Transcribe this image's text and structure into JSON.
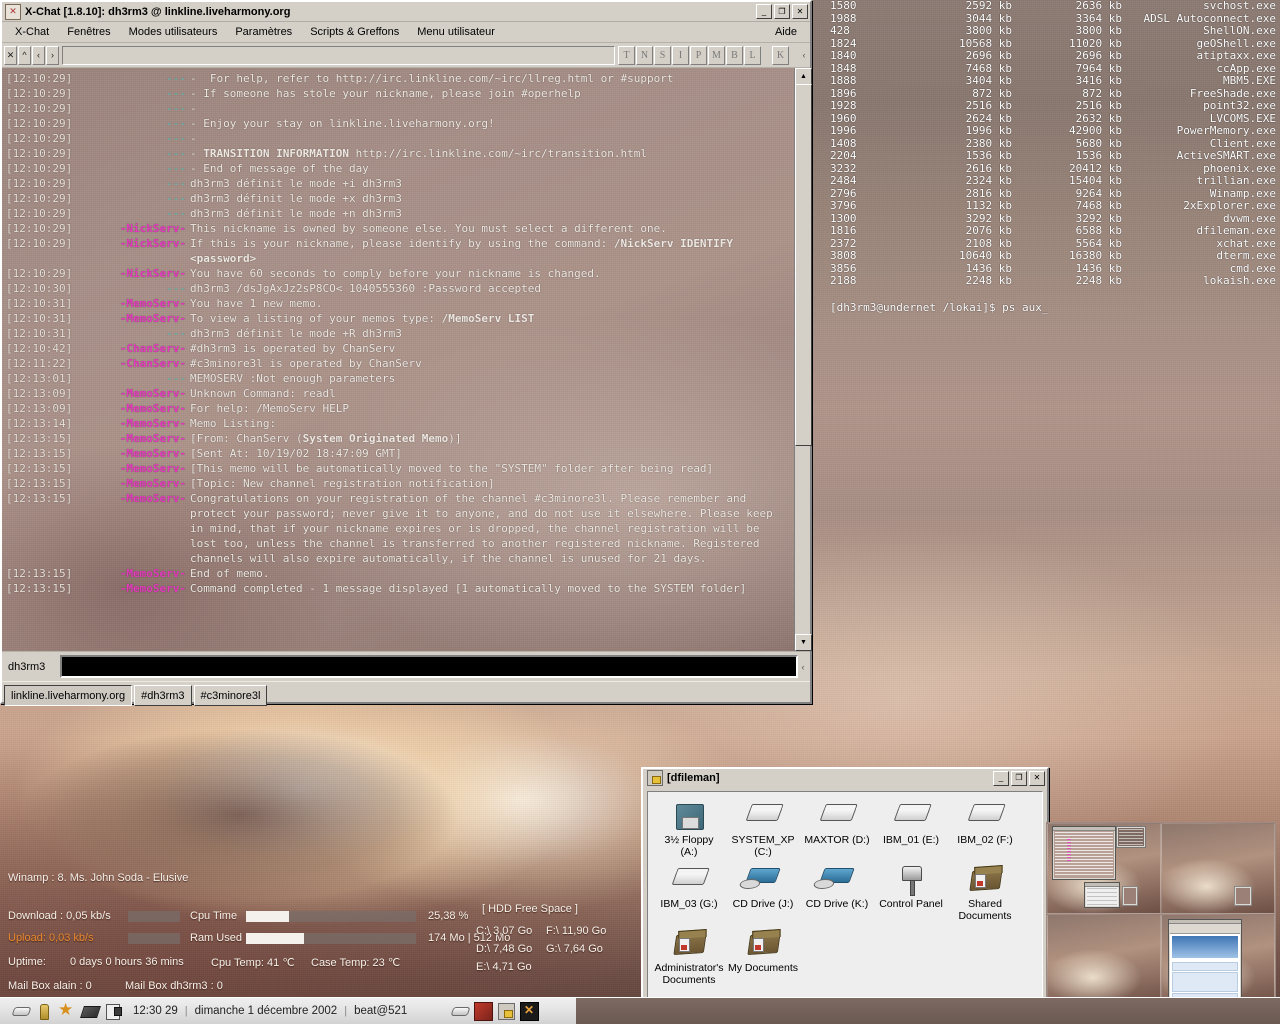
{
  "xchat": {
    "title": "X-Chat [1.8.10]: dh3rm3 @ linkline.liveharmony.org",
    "icon": "xchat-icon",
    "window_buttons": {
      "minimize": "_",
      "maximize": "❐",
      "close": "✕"
    },
    "menu": [
      "X-Chat",
      "Fenêtres",
      "Modes utilisateurs",
      "Paramètres",
      "Scripts & Greffons",
      "Menu utilisateur"
    ],
    "help_menu": "Aide",
    "toolbar": {
      "mini_buttons": [
        "✕",
        "^",
        "‹",
        "›"
      ],
      "topic_value": "",
      "mode_buttons": [
        "T",
        "N",
        "S",
        "I",
        "P",
        "M",
        "B",
        "L"
      ],
      "key_button": "K",
      "resize_grip": "‹"
    },
    "input": {
      "nick": "dh3rm3",
      "value": "",
      "grip": "‹"
    },
    "tabs": [
      {
        "label": "linkline.liveharmony.org",
        "active": true
      },
      {
        "label": "#dh3rm3",
        "active": false
      },
      {
        "label": "#c3minore3l",
        "active": false
      }
    ],
    "lines": [
      {
        "time": "[12:10:29]",
        "nick": "---",
        "nick_type": "dash",
        "msg": "-  For help, refer to http://irc.linkline.com/~irc/llreg.html or #support"
      },
      {
        "time": "[12:10:29]",
        "nick": "---",
        "nick_type": "dash",
        "msg": "- If someone has stole your nickname, please join #operhelp"
      },
      {
        "time": "[12:10:29]",
        "nick": "---",
        "nick_type": "dash",
        "msg": "-"
      },
      {
        "time": "[12:10:29]",
        "nick": "---",
        "nick_type": "dash",
        "msg": "- Enjoy your stay on linkline.liveharmony.org!"
      },
      {
        "time": "[12:10:29]",
        "nick": "---",
        "nick_type": "dash",
        "msg": "-"
      },
      {
        "time": "[12:10:29]",
        "nick": "---",
        "nick_type": "dash",
        "msg": "- TRANSITION INFORMATION http://irc.linkline.com/~irc/transition.html",
        "bold_prefix": "- ",
        "bold_part": "TRANSITION INFORMATION",
        "rest": " http://irc.linkline.com/~irc/transition.html"
      },
      {
        "time": "[12:10:29]",
        "nick": "---",
        "nick_type": "dash",
        "msg": "- End of message of the day"
      },
      {
        "time": "[12:10:29]",
        "nick": "---",
        "nick_type": "dash",
        "msg": "dh3rm3 définit le mode +i dh3rm3"
      },
      {
        "time": "[12:10:29]",
        "nick": "---",
        "nick_type": "dash",
        "msg": "dh3rm3 définit le mode +x dh3rm3"
      },
      {
        "time": "[12:10:29]",
        "nick": "---",
        "nick_type": "dash",
        "msg": "dh3rm3 définit le mode +n dh3rm3"
      },
      {
        "time": "[12:10:29]",
        "nick": "-NickServ-",
        "nick_type": "serv",
        "msg": "This nickname is owned by someone else. You must select a different one."
      },
      {
        "time": "[12:10:29]",
        "nick": "-NickServ-",
        "nick_type": "serv",
        "msg": "If this is your nickname, please identify by using the command: /NickServ IDENTIFY <password>"
      },
      {
        "time": "[12:10:29]",
        "nick": "-NickServ-",
        "nick_type": "serv",
        "msg": "You have 60 seconds to comply before your nickname is changed."
      },
      {
        "time": "[12:10:30]",
        "nick": "---",
        "nick_type": "dash",
        "msg": "dh3rm3 /dsJgAxJz2sP8CO< 1040555360 :Password accepted"
      },
      {
        "time": "[12:10:31]",
        "nick": "-MemoServ-",
        "nick_type": "serv",
        "msg": "You have 1 new memo."
      },
      {
        "time": "[12:10:31]",
        "nick": "-MemoServ-",
        "nick_type": "serv",
        "msg": "To view a listing of your memos type: /MemoServ LIST"
      },
      {
        "time": "[12:10:31]",
        "nick": "---",
        "nick_type": "dash",
        "msg": "dh3rm3 définit le mode +R dh3rm3"
      },
      {
        "time": "[12:10:42]",
        "nick": "-ChanServ-",
        "nick_type": "serv",
        "msg": "#dh3rm3 is operated by ChanServ"
      },
      {
        "time": "[12:11:22]",
        "nick": "-ChanServ-",
        "nick_type": "serv",
        "msg": "#c3minore3l is operated by ChanServ"
      },
      {
        "time": "[12:13:01]",
        "nick": "---",
        "nick_type": "dash",
        "msg": "MEMOSERV :Not enough parameters"
      },
      {
        "time": "[12:13:09]",
        "nick": "-MemoServ-",
        "nick_type": "serv",
        "msg": "Unknown Command: readl"
      },
      {
        "time": "[12:13:09]",
        "nick": "-MemoServ-",
        "nick_type": "serv",
        "msg": "For help: /MemoServ HELP"
      },
      {
        "time": "[12:13:14]",
        "nick": "-MemoServ-",
        "nick_type": "serv",
        "msg": "Memo Listing:"
      },
      {
        "time": "[12:13:15]",
        "nick": "-MemoServ-",
        "nick_type": "serv",
        "msg": "[From: ChanServ (System Originated Memo)]"
      },
      {
        "time": "[12:13:15]",
        "nick": "-MemoServ-",
        "nick_type": "serv",
        "msg": "[Sent At: 10/19/02 18:47:09 GMT]"
      },
      {
        "time": "[12:13:15]",
        "nick": "-MemoServ-",
        "nick_type": "serv",
        "msg": "[This memo will be automatically moved to the \"SYSTEM\" folder after being read]"
      },
      {
        "time": "[12:13:15]",
        "nick": "-MemoServ-",
        "nick_type": "serv",
        "msg": "[Topic: New channel registration notification]"
      },
      {
        "time": "[12:13:15]",
        "nick": "-MemoServ-",
        "nick_type": "serv",
        "msg": "Congratulations on your registration of the channel #c3minore3l. Please remember and protect your password; never give it to anyone, and do not use it elsewhere. Please keep in mind, that if your nickname expires or is dropped, the channel registration will be lost too, unless the channel is transferred to another registered nickname. Registered channels will also expire automatically, if the channel is unused for 21 days."
      },
      {
        "time": "[12:13:15]",
        "nick": "-MemoServ-",
        "nick_type": "serv",
        "msg": "End of memo."
      },
      {
        "time": "[12:13:15]",
        "nick": "-MemoServ-",
        "nick_type": "serv",
        "msg": "Command completed - 1 message displayed [1 automatically moved to the SYSTEM folder]"
      }
    ]
  },
  "terminal": {
    "prompt": "[dh3rm3@undernet /lokai]$ ps aux_",
    "rows": [
      {
        "pid": "1580",
        "mem1": "2592 kb",
        "mem2": "2636 kb",
        "name": "svchost.exe"
      },
      {
        "pid": "1988",
        "mem1": "3044 kb",
        "mem2": "3364 kb",
        "name": "ADSL Autoconnect.exe"
      },
      {
        "pid": "428",
        "mem1": "3800 kb",
        "mem2": "3800 kb",
        "name": "ShellON.exe"
      },
      {
        "pid": "1824",
        "mem1": "10568 kb",
        "mem2": "11020 kb",
        "name": "geOShell.exe"
      },
      {
        "pid": "1840",
        "mem1": "2696 kb",
        "mem2": "2696 kb",
        "name": "atiptaxx.exe"
      },
      {
        "pid": "1848",
        "mem1": "7468 kb",
        "mem2": "7964 kb",
        "name": "ccApp.exe"
      },
      {
        "pid": "1888",
        "mem1": "3404 kb",
        "mem2": "3416 kb",
        "name": "MBM5.EXE"
      },
      {
        "pid": "1896",
        "mem1": "872 kb",
        "mem2": "872 kb",
        "name": "FreeShade.exe"
      },
      {
        "pid": "1928",
        "mem1": "2516 kb",
        "mem2": "2516 kb",
        "name": "point32.exe"
      },
      {
        "pid": "1960",
        "mem1": "2624 kb",
        "mem2": "2632 kb",
        "name": "LVCOMS.EXE"
      },
      {
        "pid": "1996",
        "mem1": "1996 kb",
        "mem2": "42900 kb",
        "name": "PowerMemory.exe"
      },
      {
        "pid": "1408",
        "mem1": "2380 kb",
        "mem2": "5680 kb",
        "name": "Client.exe"
      },
      {
        "pid": "2204",
        "mem1": "1536 kb",
        "mem2": "1536 kb",
        "name": "ActiveSMART.exe"
      },
      {
        "pid": "3232",
        "mem1": "2616 kb",
        "mem2": "20412 kb",
        "name": "phoenix.exe"
      },
      {
        "pid": "2484",
        "mem1": "2324 kb",
        "mem2": "15404 kb",
        "name": "trillian.exe"
      },
      {
        "pid": "2796",
        "mem1": "2816 kb",
        "mem2": "9264 kb",
        "name": "Winamp.exe"
      },
      {
        "pid": "3796",
        "mem1": "1132 kb",
        "mem2": "7468 kb",
        "name": "2xExplorer.exe"
      },
      {
        "pid": "1300",
        "mem1": "3292 kb",
        "mem2": "3292 kb",
        "name": "dvwm.exe"
      },
      {
        "pid": "1816",
        "mem1": "2076 kb",
        "mem2": "6588 kb",
        "name": "dfileman.exe"
      },
      {
        "pid": "2372",
        "mem1": "2108 kb",
        "mem2": "5564 kb",
        "name": "xchat.exe"
      },
      {
        "pid": "3808",
        "mem1": "10640 kb",
        "mem2": "16380 kb",
        "name": "dterm.exe"
      },
      {
        "pid": "3856",
        "mem1": "1436 kb",
        "mem2": "1436 kb",
        "name": "cmd.exe"
      },
      {
        "pid": "2188",
        "mem1": "2248 kb",
        "mem2": "2248 kb",
        "name": "lokaish.exe"
      }
    ]
  },
  "stats": {
    "winamp": "Winamp : 8. Ms. John Soda - Elusive",
    "download": "Download : 0,05 kb/s",
    "upload": "Upload: 0,03 kb/s",
    "cpu_time_label": "Cpu Time",
    "cpu_time_value": "25,38 %",
    "cpu_time_pct": 25.38,
    "ram_used_label": "Ram Used",
    "ram_used_value": "174 Mo | 512 Mo",
    "ram_used_pct": 34,
    "uptime_label": "Uptime:",
    "uptime_value": "0 days 0 hours 36 mins",
    "cpu_temp": "Cpu Temp: 41 ℃",
    "case_temp": "Case Temp: 23 ℃",
    "mailbox_alain": "Mail Box alain : 0",
    "mailbox_dh3rm3": "Mail Box dh3rm3 : 0",
    "hdd_title": "[ HDD Free Space ]",
    "hdd": [
      {
        "label": "C:\\ 3,07 Go"
      },
      {
        "label": "F:\\ 11,90 Go"
      },
      {
        "label": "D:\\ 7,48 Go"
      },
      {
        "label": "G:\\ 7,64 Go"
      },
      {
        "label": "E:\\ 4,71 Go"
      }
    ]
  },
  "dfileman": {
    "title": "[dfileman]",
    "window_buttons": {
      "minimize": "_",
      "maximize": "❐",
      "close": "✕"
    },
    "items": [
      {
        "label": "3½ Floppy\n(A:)",
        "icon": "floppy-drive-icon"
      },
      {
        "label": "SYSTEM_XP\n(C:)",
        "icon": "hard-drive-icon"
      },
      {
        "label": "MAXTOR (D:)",
        "icon": "hard-drive-icon"
      },
      {
        "label": "IBM_01 (E:)",
        "icon": "hard-drive-icon"
      },
      {
        "label": "IBM_02 (F:)",
        "icon": "hard-drive-icon"
      },
      {
        "label": "IBM_03 (G:)",
        "icon": "hard-drive-icon"
      },
      {
        "label": "CD Drive (J:)",
        "icon": "cd-drive-icon"
      },
      {
        "label": "CD Drive (K:)",
        "icon": "cd-drive-icon"
      },
      {
        "label": "Control Panel",
        "icon": "control-panel-icon"
      },
      {
        "label": "Shared\nDocuments",
        "icon": "folder-icon"
      },
      {
        "label": "Administrator's\nDocuments",
        "icon": "folder-icon"
      },
      {
        "label": "My Documents",
        "icon": "folder-icon"
      }
    ]
  },
  "taskbar": {
    "launchers": [
      "disc-icon",
      "person-icon",
      "star-icon",
      "book-icon",
      "plug-icon"
    ],
    "clock": "12:30 29",
    "separator": "|",
    "date": "dimanche 1 décembre 2002",
    "user": "beat@521",
    "tray": [
      "disc-icon",
      "dragon-icon",
      "lock-icon",
      "xchat-icon"
    ]
  },
  "pager": {
    "desktops": 4,
    "active": 1
  },
  "colors": {
    "chrome": "#d4d0c8",
    "serv_nick": "#e838c0",
    "dash_nick": "#5fd6cf",
    "chat_text": "#f2ece6",
    "upload_text": "#e8892e",
    "terminal_text": "#ffffff"
  }
}
